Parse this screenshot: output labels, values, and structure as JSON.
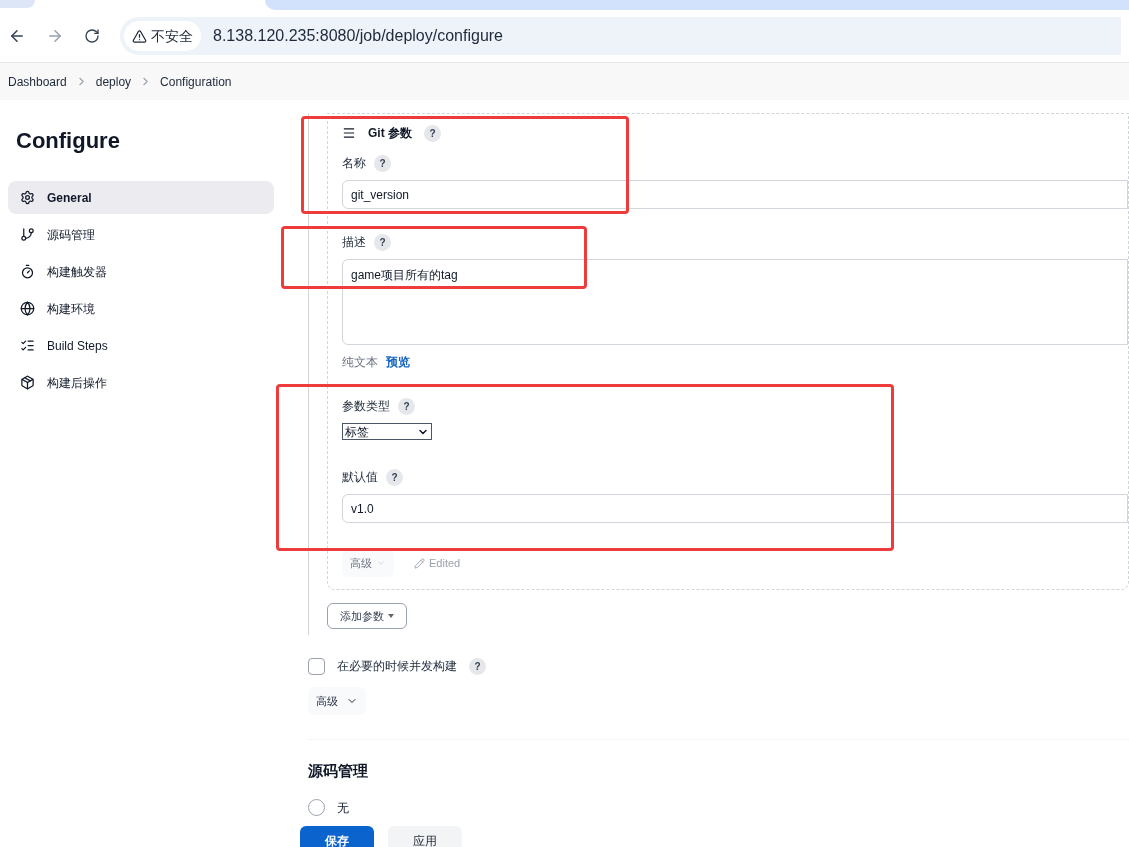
{
  "browser": {
    "security_label": "不安全",
    "url": "8.138.120.235:8080/job/deploy/configure"
  },
  "breadcrumbs": [
    "Dashboard",
    "deploy",
    "Configuration"
  ],
  "sidebar": {
    "title": "Configure",
    "items": [
      {
        "label": "General",
        "selected": true
      },
      {
        "label": "源码管理",
        "selected": false
      },
      {
        "label": "构建触发器",
        "selected": false
      },
      {
        "label": "构建环境",
        "selected": false
      },
      {
        "label": "Build Steps",
        "selected": false
      },
      {
        "label": "构建后操作",
        "selected": false
      }
    ]
  },
  "parameter": {
    "title": "Git 参数",
    "help": "?",
    "name": {
      "label": "名称",
      "help": "?",
      "value": "git_version"
    },
    "description": {
      "label": "描述",
      "help": "?",
      "value": "game项目所有的tag",
      "plain_text": "纯文本",
      "preview": "预览"
    },
    "type": {
      "label": "参数类型",
      "help": "?",
      "value": "标签"
    },
    "default": {
      "label": "默认值",
      "help": "?",
      "value": "v1.0"
    },
    "advanced": "高级",
    "edited": "Edited"
  },
  "add_parameter": "添加参数",
  "concurrent": {
    "label": "在必要的时候并发构建",
    "help": "?",
    "checked": false
  },
  "advanced": "高级",
  "section": {
    "title": "源码管理",
    "options": [
      {
        "label": "无",
        "selected": false
      }
    ]
  },
  "footer": {
    "save": "保存",
    "apply": "应用"
  }
}
